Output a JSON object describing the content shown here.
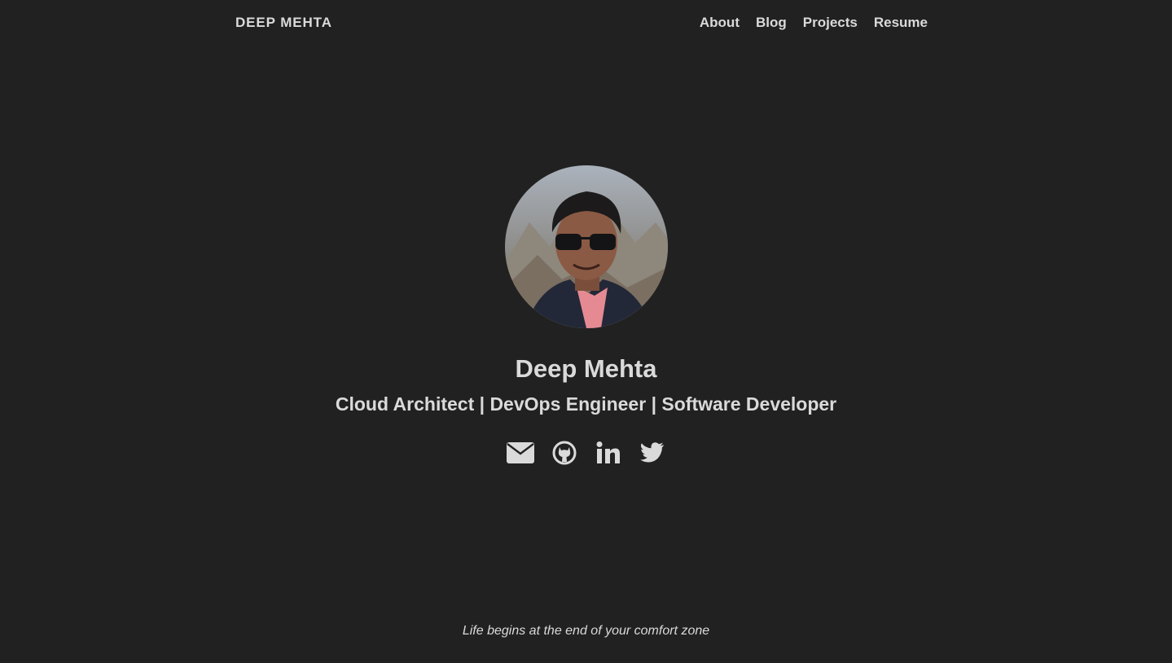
{
  "header": {
    "brand": "DEEP MEHTA",
    "nav": [
      {
        "label": "About"
      },
      {
        "label": "Blog"
      },
      {
        "label": "Projects"
      },
      {
        "label": "Resume"
      }
    ]
  },
  "profile": {
    "name": "Deep Mehta",
    "tagline": "Cloud Architect | DevOps Engineer | Software Developer",
    "photo": "avatar-photo"
  },
  "social": [
    {
      "icon": "envelope-icon"
    },
    {
      "icon": "github-icon"
    },
    {
      "icon": "linkedin-icon"
    },
    {
      "icon": "twitter-icon"
    }
  ],
  "footer": {
    "quote": "Life begins at the end of your comfort zone"
  },
  "colors": {
    "background": "#212121",
    "text": "#dadada"
  }
}
